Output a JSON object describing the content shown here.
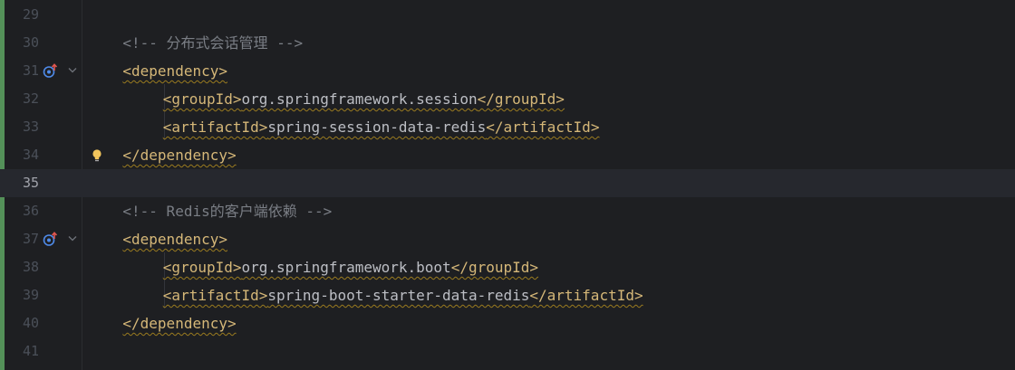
{
  "editor": {
    "lines": [
      {
        "number": "29",
        "comment": "",
        "tag_open": "",
        "text": "",
        "tag_close": "",
        "indent": 0
      },
      {
        "number": "30",
        "comment": "<!-- 分布式会话管理 -->",
        "indent": 1
      },
      {
        "number": "31",
        "tag_open": "<dependency>",
        "indent": 1,
        "gutter": [
          "implemented-icon",
          "fold-arrow-icon"
        ]
      },
      {
        "number": "32",
        "tag_open": "<groupId>",
        "text": "org.springframework.session",
        "tag_close": "</groupId>",
        "indent": 2
      },
      {
        "number": "33",
        "tag_open": "<artifactId>",
        "text": "spring-session-data-redis",
        "tag_close": "</artifactId>",
        "indent": 2
      },
      {
        "number": "34",
        "tag_open": "</dependency>",
        "indent": 1,
        "gutter": [
          "lightbulb-icon"
        ]
      },
      {
        "number": "35",
        "indent": 0,
        "current": true
      },
      {
        "number": "36",
        "comment": "<!-- Redis的客户端依赖 -->",
        "indent": 1
      },
      {
        "number": "37",
        "tag_open": "<dependency>",
        "indent": 1,
        "gutter": [
          "implemented-icon",
          "fold-arrow-icon"
        ]
      },
      {
        "number": "38",
        "tag_open": "<groupId>",
        "text": "org.springframework.boot",
        "tag_close": "</groupId>",
        "indent": 2
      },
      {
        "number": "39",
        "tag_open": "<artifactId>",
        "text": "spring-boot-starter-data-redis",
        "tag_close": "</artifactId>",
        "indent": 2
      },
      {
        "number": "40",
        "tag_open": "</dependency>",
        "indent": 1
      },
      {
        "number": "41",
        "indent": 0
      }
    ]
  },
  "colors": {
    "background": "#1e1f22",
    "current_line": "#26282e",
    "line_number": "#4b5059",
    "tag": "#d5b778",
    "comment": "#7a7e85",
    "text": "#bcbec4",
    "vcs_added": "#549159",
    "warning_squiggle": "#9a7b1f"
  }
}
